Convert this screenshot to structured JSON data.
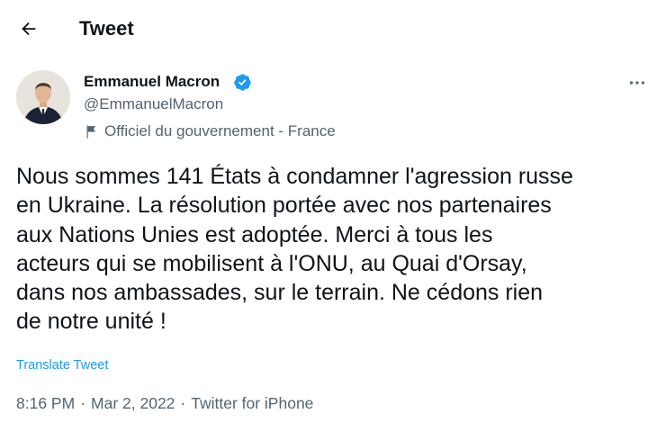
{
  "header": {
    "title": "Tweet"
  },
  "author": {
    "name": "Emmanuel Macron",
    "handle": "@EmmanuelMacron",
    "verified": true,
    "label": "Officiel du gouvernement - France"
  },
  "tweet": {
    "text": "Nous sommes 141 États à condamner l'agression russe\nen Ukraine. La résolution portée avec nos partenaires\naux Nations Unies est adoptée. Merci à tous les\nacteurs qui se mobilisent à l'ONU, au Quai d'Orsay,\ndans nos ambassades, sur le terrain. Ne cédons rien\nde notre unité !",
    "translate_label": "Translate Tweet"
  },
  "meta": {
    "time": "8:16 PM",
    "separator": "·",
    "date": "Mar 2, 2022",
    "source": "Twitter for iPhone"
  },
  "colors": {
    "accent": "#1d9bf0",
    "text_primary": "#0f1419",
    "text_secondary": "#536471"
  },
  "icons": {
    "back": "arrow-left-icon",
    "verified": "verified-badge-icon",
    "more": "more-horizontal-icon",
    "government": "flag-icon"
  }
}
